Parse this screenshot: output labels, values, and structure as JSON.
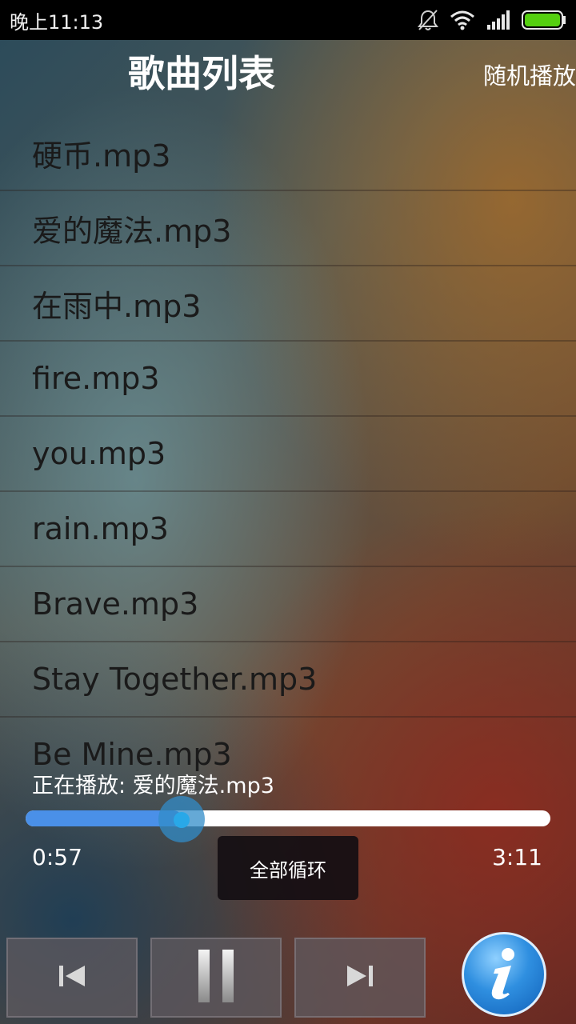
{
  "status_bar": {
    "time": "晚上11:13",
    "icons": [
      "bell-off-icon",
      "wifi-icon",
      "signal-icon",
      "battery-icon"
    ],
    "battery_color": "#55d010"
  },
  "header": {
    "title": "歌曲列表",
    "shuffle_label": "随机播放"
  },
  "songs": [
    "硬币.mp3",
    "爱的魔法.mp3",
    "在雨中.mp3",
    "fire.mp3",
    "you.mp3",
    "rain.mp3",
    "Brave.mp3",
    "Stay Together.mp3",
    "Be Mine.mp3"
  ],
  "player": {
    "now_playing_label": "正在播放: 爱的魔法.mp3",
    "elapsed": "0:57",
    "total": "3:11",
    "progress": 0.298,
    "accent_color": "#4a90e8"
  },
  "toast": {
    "text": "全部循环"
  },
  "controls": {
    "prev_icon": "skip-previous-icon",
    "pause_icon": "pause-icon",
    "next_icon": "skip-next-icon",
    "info_icon": "info-icon"
  }
}
